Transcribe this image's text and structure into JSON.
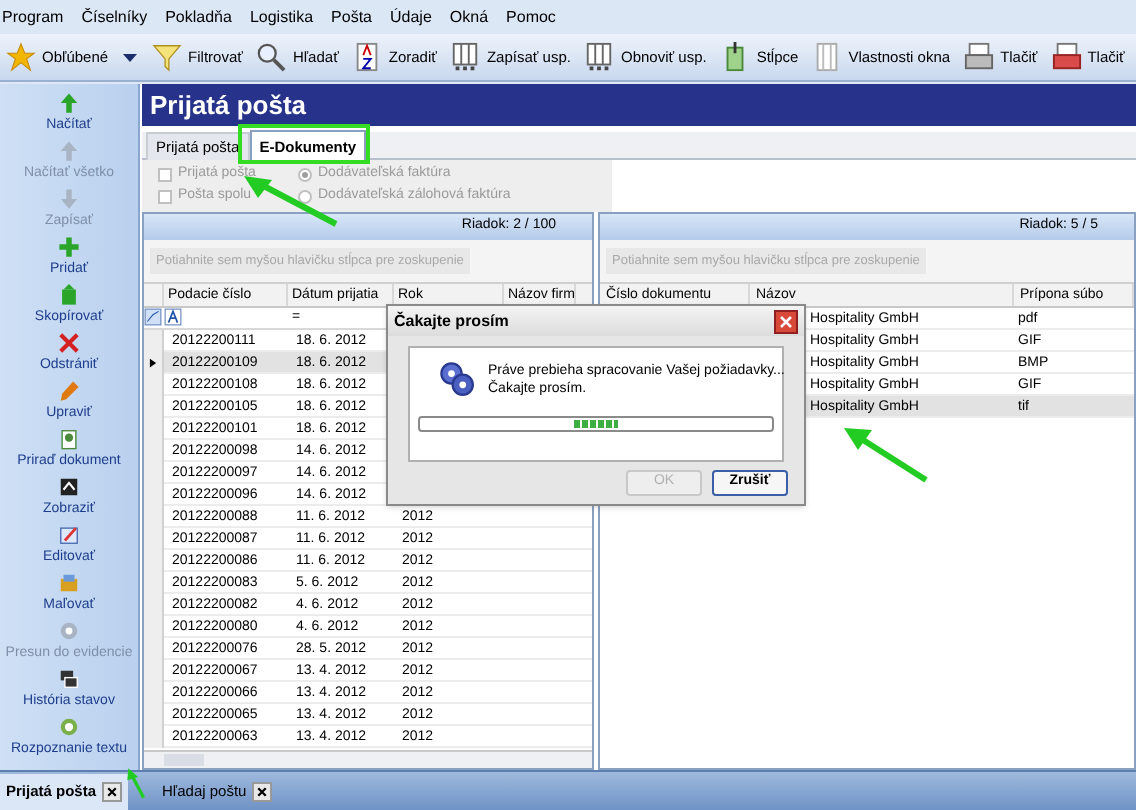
{
  "menu": [
    "Program",
    "Číselníky",
    "Pokladňa",
    "Logistika",
    "Pošta",
    "Údaje",
    "Okná",
    "Pomoc"
  ],
  "toolbar": [
    {
      "label": "Obľúbené",
      "has_menu": true
    },
    {
      "label": "Filtrovať",
      "has_menu": false
    },
    {
      "label": "Hľadať",
      "has_menu": false
    },
    {
      "label": "Zoradiť",
      "has_menu": false
    },
    {
      "label": "Zapísať usp.",
      "has_menu": false
    },
    {
      "label": "Obnoviť usp.",
      "has_menu": false
    },
    {
      "label": "Stĺpce",
      "has_menu": false
    },
    {
      "label": "Vlastnosti okna",
      "has_menu": false
    },
    {
      "label": "Tlačiť",
      "has_menu": false
    },
    {
      "label": "Tlačiť",
      "has_menu": false
    }
  ],
  "sidebar": [
    {
      "label": "Načítať",
      "disabled": false
    },
    {
      "label": "Načítať všetko",
      "disabled": true
    },
    {
      "label": "Zapísať",
      "disabled": true
    },
    {
      "label": "Pridať",
      "disabled": false
    },
    {
      "label": "Skopírovať",
      "disabled": false
    },
    {
      "label": "Odstrániť",
      "disabled": false
    },
    {
      "label": "Upraviť",
      "disabled": false
    },
    {
      "label": "Priraď dokument",
      "disabled": false
    },
    {
      "label": "Zobraziť",
      "disabled": false
    },
    {
      "label": "Editovať",
      "disabled": false
    },
    {
      "label": "Maľovať",
      "disabled": false
    },
    {
      "label": "Presun do evidencie",
      "disabled": true
    },
    {
      "label": "História stavov",
      "disabled": false
    },
    {
      "label": "Rozpoznanie textu",
      "disabled": false
    }
  ],
  "window": {
    "title": "Prijatá pošta"
  },
  "tabs": [
    {
      "label": "Prijatá pošta",
      "selected": false
    },
    {
      "label": "E-Dokumenty",
      "selected": true
    }
  ],
  "filters": [
    {
      "kind": "checkbox",
      "label": "Prijatá pošta",
      "checked": false,
      "disabled": true
    },
    {
      "kind": "radio",
      "label": "Dodávateľská faktúra",
      "checked": true,
      "disabled": true
    },
    {
      "kind": "checkbox",
      "label": "Pošta spolu",
      "checked": false,
      "disabled": true
    },
    {
      "kind": "radio",
      "label": "Dodávateľská zálohová faktúra",
      "checked": false,
      "disabled": true
    }
  ],
  "left_grid": {
    "row_counter": "Riadok: 2 / 100",
    "group_hint": "Potiahnite sem myšou hlavičku stĺpca pre zoskupenie",
    "columns": [
      "Podacie číslo",
      "Dátum prijatia",
      "Rok",
      "Názov firm"
    ],
    "date_filter": "=",
    "rows": [
      {
        "cells": [
          "20122200111",
          "18. 6. 2012"
        ],
        "selected": false
      },
      {
        "cells": [
          "20122200109",
          "18. 6. 2012"
        ],
        "selected": true
      },
      {
        "cells": [
          "20122200108",
          "18. 6. 2012"
        ],
        "selected": false
      },
      {
        "cells": [
          "20122200105",
          "18. 6. 2012"
        ],
        "selected": false
      },
      {
        "cells": [
          "20122200101",
          "18. 6. 2012"
        ],
        "selected": false
      },
      {
        "cells": [
          "20122200098",
          "14. 6. 2012"
        ],
        "selected": false
      },
      {
        "cells": [
          "20122200097",
          "14. 6. 2012"
        ],
        "selected": false
      },
      {
        "cells": [
          "20122200096",
          "14. 6. 2012"
        ],
        "selected": false
      },
      {
        "cells": [
          "20122200088",
          "11. 6. 2012",
          "2012"
        ],
        "selected": false
      },
      {
        "cells": [
          "20122200087",
          "11. 6. 2012",
          "2012"
        ],
        "selected": false
      },
      {
        "cells": [
          "20122200086",
          "11. 6. 2012",
          "2012"
        ],
        "selected": false
      },
      {
        "cells": [
          "20122200083",
          "5. 6. 2012",
          "2012"
        ],
        "selected": false
      },
      {
        "cells": [
          "20122200082",
          "4. 6. 2012",
          "2012"
        ],
        "selected": false
      },
      {
        "cells": [
          "20122200080",
          "4. 6. 2012",
          "2012"
        ],
        "selected": false
      },
      {
        "cells": [
          "20122200076",
          "28. 5. 2012",
          "2012"
        ],
        "selected": false
      },
      {
        "cells": [
          "20122200067",
          "13. 4. 2012",
          "2012"
        ],
        "selected": false
      },
      {
        "cells": [
          "20122200066",
          "13. 4. 2012",
          "2012"
        ],
        "selected": false
      },
      {
        "cells": [
          "20122200065",
          "13. 4. 2012",
          "2012"
        ],
        "selected": false
      },
      {
        "cells": [
          "20122200063",
          "13. 4. 2012",
          "2012"
        ],
        "selected": false
      }
    ]
  },
  "right_grid": {
    "row_counter": "Riadok: 5 / 5",
    "group_hint": "Potiahnite sem myšou hlavičku stĺpca pre zoskupenie",
    "columns": [
      "Číslo dokumentu",
      "Názov",
      "Prípona súbo"
    ],
    "rows": [
      {
        "cells": [
          "Hospitality GmbH",
          "pdf"
        ],
        "selected": false
      },
      {
        "cells": [
          "Hospitality GmbH",
          "GIF"
        ],
        "selected": false
      },
      {
        "cells": [
          "Hospitality GmbH",
          "BMP"
        ],
        "selected": false
      },
      {
        "cells": [
          "Hospitality GmbH",
          "GIF"
        ],
        "selected": false
      },
      {
        "cells": [
          "Hospitality GmbH",
          "tif"
        ],
        "selected": true
      }
    ]
  },
  "dialog": {
    "title": "Čakajte prosím",
    "message": "Práve prebieha spracovanie Vašej požiadavky...",
    "submessage": "Čakajte prosím.",
    "buttons": [
      {
        "label": "OK",
        "disabled": true
      },
      {
        "label": "Zrušiť",
        "disabled": false
      }
    ]
  },
  "taskbar": [
    {
      "label": "Prijatá pošta",
      "selected": true
    },
    {
      "label": "Hľadaj poštu",
      "selected": false
    }
  ]
}
